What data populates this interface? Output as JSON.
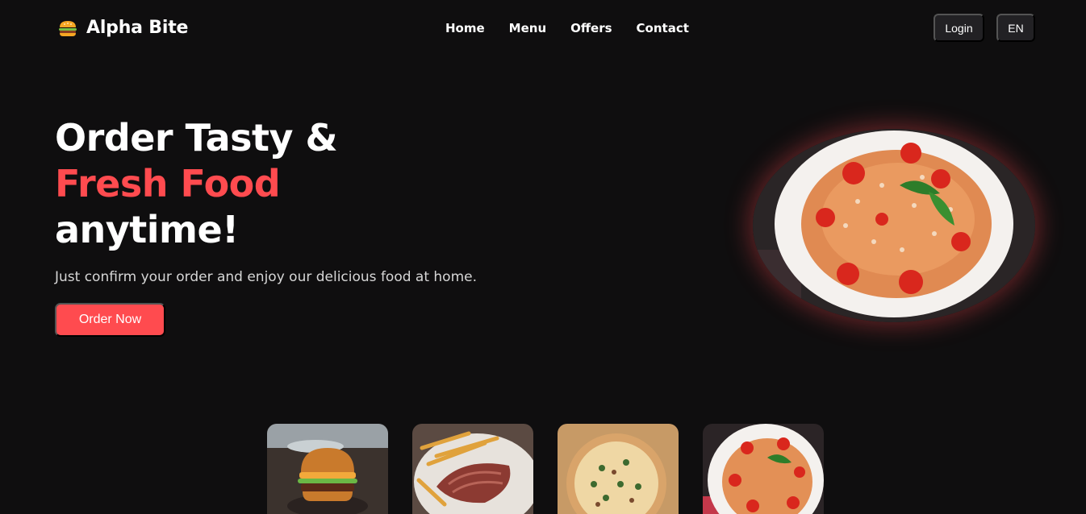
{
  "brand": {
    "name": "Alpha Bite",
    "icon": "burger-icon"
  },
  "nav": {
    "links": [
      "Home",
      "Menu",
      "Offers",
      "Contact"
    ],
    "login_label": "Login",
    "lang_label": "EN"
  },
  "hero": {
    "title_line1": "Order Tasty &",
    "title_line2": "Fresh Food",
    "title_line3": "anytime!",
    "subtitle": "Just confirm your order and enjoy our delicious food at home.",
    "cta_label": "Order Now",
    "image": "pasta-dish-image"
  },
  "colors": {
    "accent": "#ff4b4f",
    "background": "#0f0e0f",
    "button_dark": "#222124"
  },
  "food_cards": [
    {
      "image": "burger-image"
    },
    {
      "image": "steak-fries-image"
    },
    {
      "image": "pizza-image"
    },
    {
      "image": "pasta-image"
    }
  ]
}
